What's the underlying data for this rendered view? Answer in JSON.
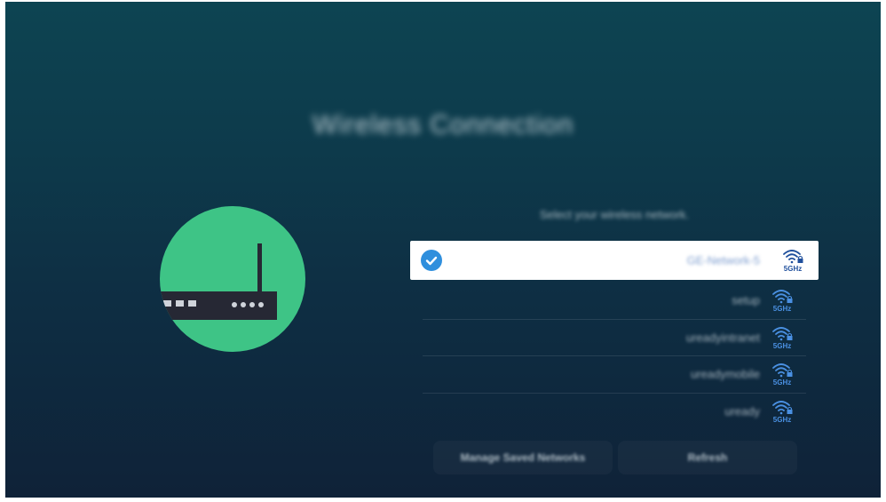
{
  "page": {
    "title": "Wireless Connection",
    "subtitle": "Select your wireless network."
  },
  "networks": [
    {
      "name": "GE-Network-5",
      "band": "5GHz",
      "selected": true
    },
    {
      "name": "setup",
      "band": "5GHz",
      "selected": false
    },
    {
      "name": "ureadyintranet",
      "band": "5GHz",
      "selected": false
    },
    {
      "name": "ureadymobile",
      "band": "5GHz",
      "selected": false
    },
    {
      "name": "uready",
      "band": "5GHz",
      "selected": false
    }
  ],
  "buttons": {
    "manage": "Manage Saved Networks",
    "refresh": "Refresh"
  },
  "colors": {
    "accent": "#2f8fdd",
    "illustration": "#3ec486",
    "router": "#262834"
  },
  "icons": {
    "check": "check-circle-icon",
    "wifi": "wifi-lock-icon",
    "router": "router-icon"
  }
}
